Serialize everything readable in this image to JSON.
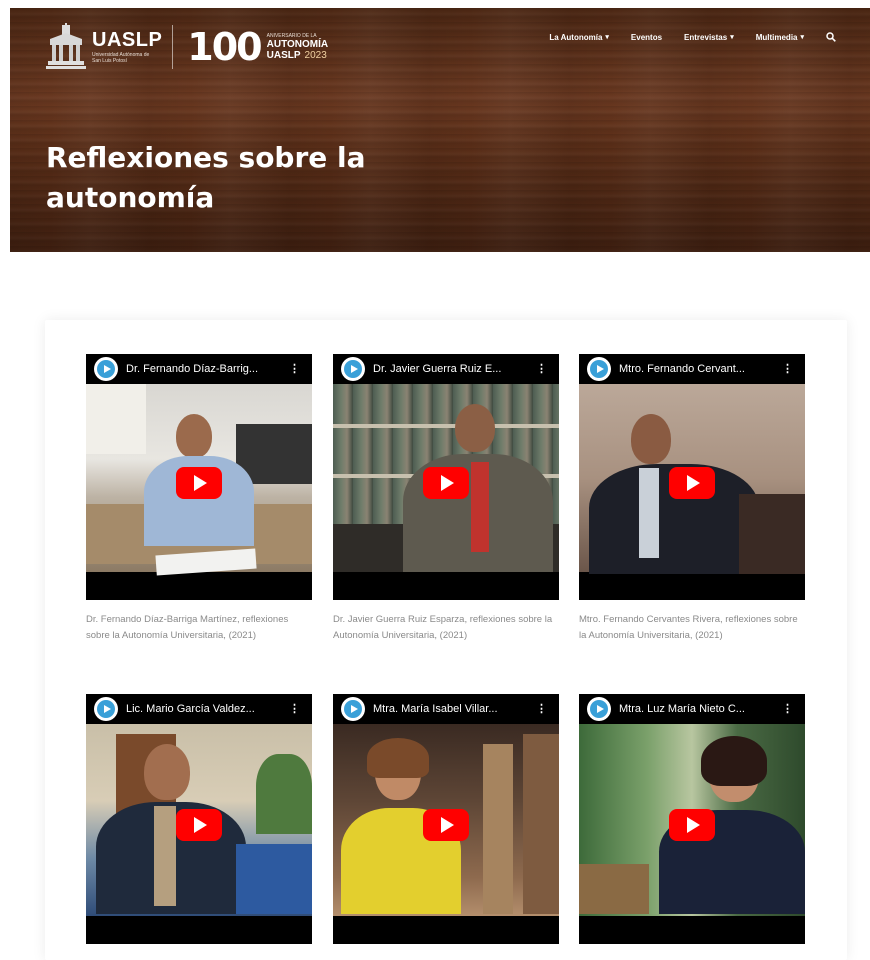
{
  "header": {
    "brand_name": "UASLP",
    "brand_sub": "Universidad Autónoma de San Luis Potosí",
    "centenario_number": "100",
    "centenario_line1": "ANIVERSARIO DE LA",
    "centenario_line2": "AUTONOMÍA",
    "centenario_line3": "UASLP",
    "centenario_year": "2023",
    "nav": [
      {
        "label": "La Autonomía",
        "has_dropdown": true
      },
      {
        "label": "Eventos",
        "has_dropdown": false
      },
      {
        "label": "Entrevistas",
        "has_dropdown": true
      },
      {
        "label": "Multimedia",
        "has_dropdown": true
      }
    ],
    "search_icon": "search-icon"
  },
  "hero": {
    "title": "Reflexiones sobre la autonomía"
  },
  "videos": [
    {
      "title": "Dr. Fernando Díaz-Barrig...",
      "caption": "Dr. Fernando Díaz-Barriga Martínez, reflexiones sobre la Autonomía Universitaria, (2021)"
    },
    {
      "title": "Dr. Javier Guerra Ruiz E...",
      "caption": "Dr. Javier Guerra Ruiz Esparza, reflexiones sobre la Autonomía Universitaria, (2021)"
    },
    {
      "title": "Mtro. Fernando Cervant...",
      "caption": "Mtro. Fernando Cervantes Rivera, reflexiones sobre la Autonomía Universitaria, (2021)"
    },
    {
      "title": "Lic. Mario García Valdez...",
      "caption": ""
    },
    {
      "title": "Mtra. María Isabel Villar...",
      "caption": ""
    },
    {
      "title": "Mtra. Luz María Nieto C...",
      "caption": ""
    }
  ],
  "colors": {
    "play_button": "#ff0000",
    "caption_text": "#8a8a8a",
    "wood_brown": "#5a2e17"
  }
}
